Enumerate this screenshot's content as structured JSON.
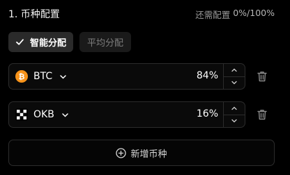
{
  "header": {
    "title": "1. 币种配置",
    "remaining_label": "还需配置",
    "remaining_value": "0%/100%"
  },
  "tabs": [
    {
      "label": "智能分配",
      "active": true
    },
    {
      "label": "平均分配",
      "active": false
    }
  ],
  "allocations": [
    {
      "coin": "BTC",
      "percent": "84%",
      "icon": "bitcoin-icon",
      "icon_color": "#f7931a"
    },
    {
      "coin": "OKB",
      "percent": "16%",
      "icon": "okb-icon",
      "icon_color": "#ffffff"
    }
  ],
  "add_button": {
    "label": "新增币种",
    "icon": "plus-circle-icon"
  },
  "colors": {
    "background": "#000000",
    "border": "#2c2c2c",
    "active_tab": "#2a2a2a"
  }
}
